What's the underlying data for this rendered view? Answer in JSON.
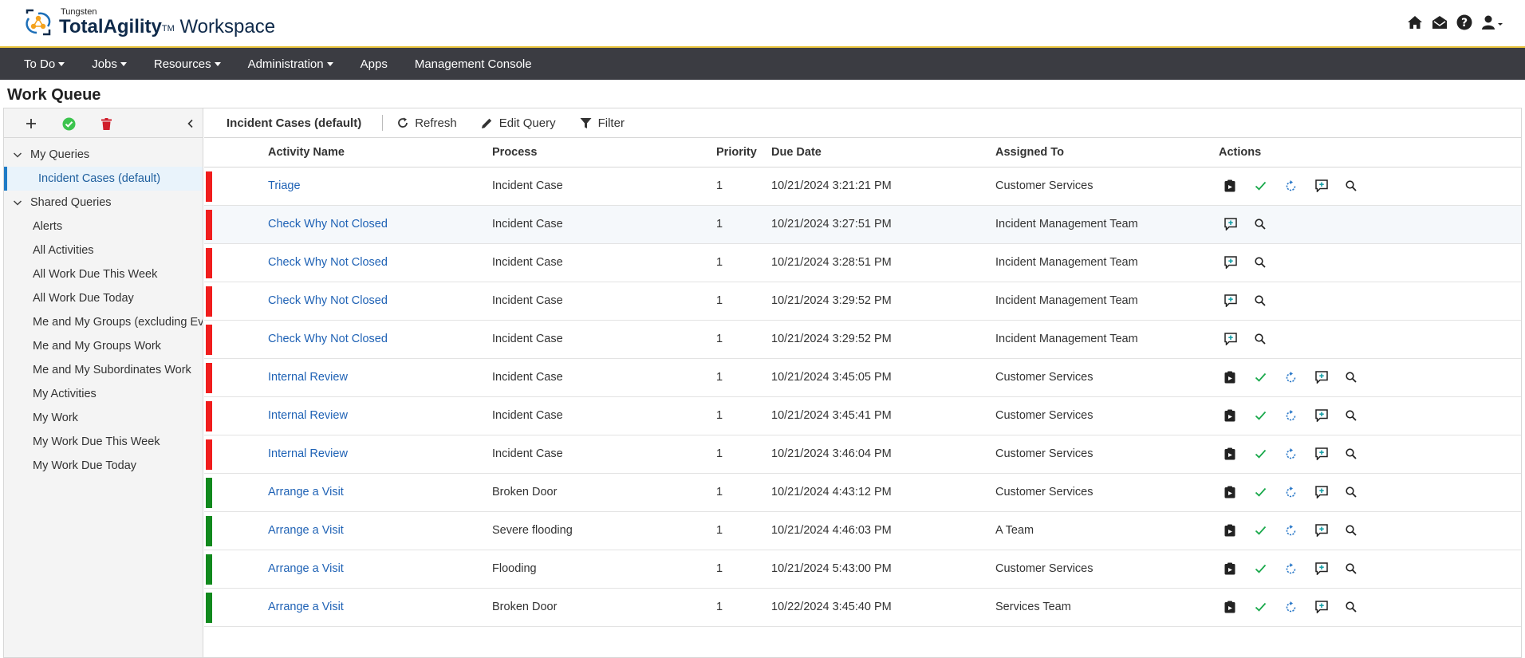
{
  "app": {
    "brand_small": "Tungsten",
    "brand_bold": "TotalAgility",
    "brand_tm": "TM",
    "brand_rest": "Workspace"
  },
  "nav": [
    {
      "label": "To Do",
      "dropdown": true
    },
    {
      "label": "Jobs",
      "dropdown": true
    },
    {
      "label": "Resources",
      "dropdown": true
    },
    {
      "label": "Administration",
      "dropdown": true
    },
    {
      "label": "Apps",
      "dropdown": false
    },
    {
      "label": "Management Console",
      "dropdown": false
    }
  ],
  "page_title": "Work Queue",
  "sidebar": {
    "groups": [
      {
        "label": "My Queries",
        "items": [
          {
            "label": "Incident Cases (default)",
            "selected": true
          }
        ]
      },
      {
        "label": "Shared Queries",
        "items": [
          {
            "label": "Alerts"
          },
          {
            "label": "All Activities"
          },
          {
            "label": "All Work Due This Week"
          },
          {
            "label": "All Work Due Today"
          },
          {
            "label": "Me and My Groups (excluding Ev"
          },
          {
            "label": "Me and My Groups Work"
          },
          {
            "label": "Me and My Subordinates Work"
          },
          {
            "label": "My Activities"
          },
          {
            "label": "My Work"
          },
          {
            "label": "My Work Due This Week"
          },
          {
            "label": "My Work Due Today"
          }
        ]
      }
    ]
  },
  "toolbar": {
    "query_name": "Incident Cases (default)",
    "refresh": "Refresh",
    "edit_query": "Edit Query",
    "filter": "Filter"
  },
  "table": {
    "headers": {
      "activity": "Activity Name",
      "process": "Process",
      "priority": "Priority",
      "due": "Due Date",
      "assigned": "Assigned To",
      "actions": "Actions"
    },
    "rows": [
      {
        "status": "red",
        "activity": "Triage",
        "process": "Incident Case",
        "priority": "1",
        "due": "10/21/2024 3:21:21 PM",
        "assigned": "Customer Services",
        "full_actions": true
      },
      {
        "status": "red",
        "activity": "Check Why Not Closed",
        "process": "Incident Case",
        "priority": "1",
        "due": "10/21/2024 3:27:51 PM",
        "assigned": "Incident Management Team",
        "full_actions": false
      },
      {
        "status": "red",
        "activity": "Check Why Not Closed",
        "process": "Incident Case",
        "priority": "1",
        "due": "10/21/2024 3:28:51 PM",
        "assigned": "Incident Management Team",
        "full_actions": false
      },
      {
        "status": "red",
        "activity": "Check Why Not Closed",
        "process": "Incident Case",
        "priority": "1",
        "due": "10/21/2024 3:29:52 PM",
        "assigned": "Incident Management Team",
        "full_actions": false
      },
      {
        "status": "red",
        "activity": "Check Why Not Closed",
        "process": "Incident Case",
        "priority": "1",
        "due": "10/21/2024 3:29:52 PM",
        "assigned": "Incident Management Team",
        "full_actions": false
      },
      {
        "status": "red",
        "activity": "Internal Review",
        "process": "Incident Case",
        "priority": "1",
        "due": "10/21/2024 3:45:05 PM",
        "assigned": "Customer Services",
        "full_actions": true
      },
      {
        "status": "red",
        "activity": "Internal Review",
        "process": "Incident Case",
        "priority": "1",
        "due": "10/21/2024 3:45:41 PM",
        "assigned": "Customer Services",
        "full_actions": true
      },
      {
        "status": "red",
        "activity": "Internal Review",
        "process": "Incident Case",
        "priority": "1",
        "due": "10/21/2024 3:46:04 PM",
        "assigned": "Customer Services",
        "full_actions": true
      },
      {
        "status": "green",
        "activity": "Arrange a Visit",
        "process": "Broken Door",
        "priority": "1",
        "due": "10/21/2024 4:43:12 PM",
        "assigned": "Customer Services",
        "full_actions": true
      },
      {
        "status": "green",
        "activity": "Arrange a Visit",
        "process": "Severe flooding",
        "priority": "1",
        "due": "10/21/2024 4:46:03 PM",
        "assigned": "A Team",
        "full_actions": true
      },
      {
        "status": "green",
        "activity": "Arrange a Visit",
        "process": "Flooding",
        "priority": "1",
        "due": "10/21/2024 5:43:00 PM",
        "assigned": "Customer Services",
        "full_actions": true
      },
      {
        "status": "green",
        "activity": "Arrange a Visit",
        "process": "Broken Door",
        "priority": "1",
        "due": "10/22/2024 3:45:40 PM",
        "assigned": "Services Team",
        "full_actions": true
      }
    ]
  },
  "colors": {
    "red": "#f01d1d",
    "green": "#11891d",
    "nav_bg": "#3b3c42",
    "link": "#1f62b5",
    "accent": "#e8c23a"
  }
}
